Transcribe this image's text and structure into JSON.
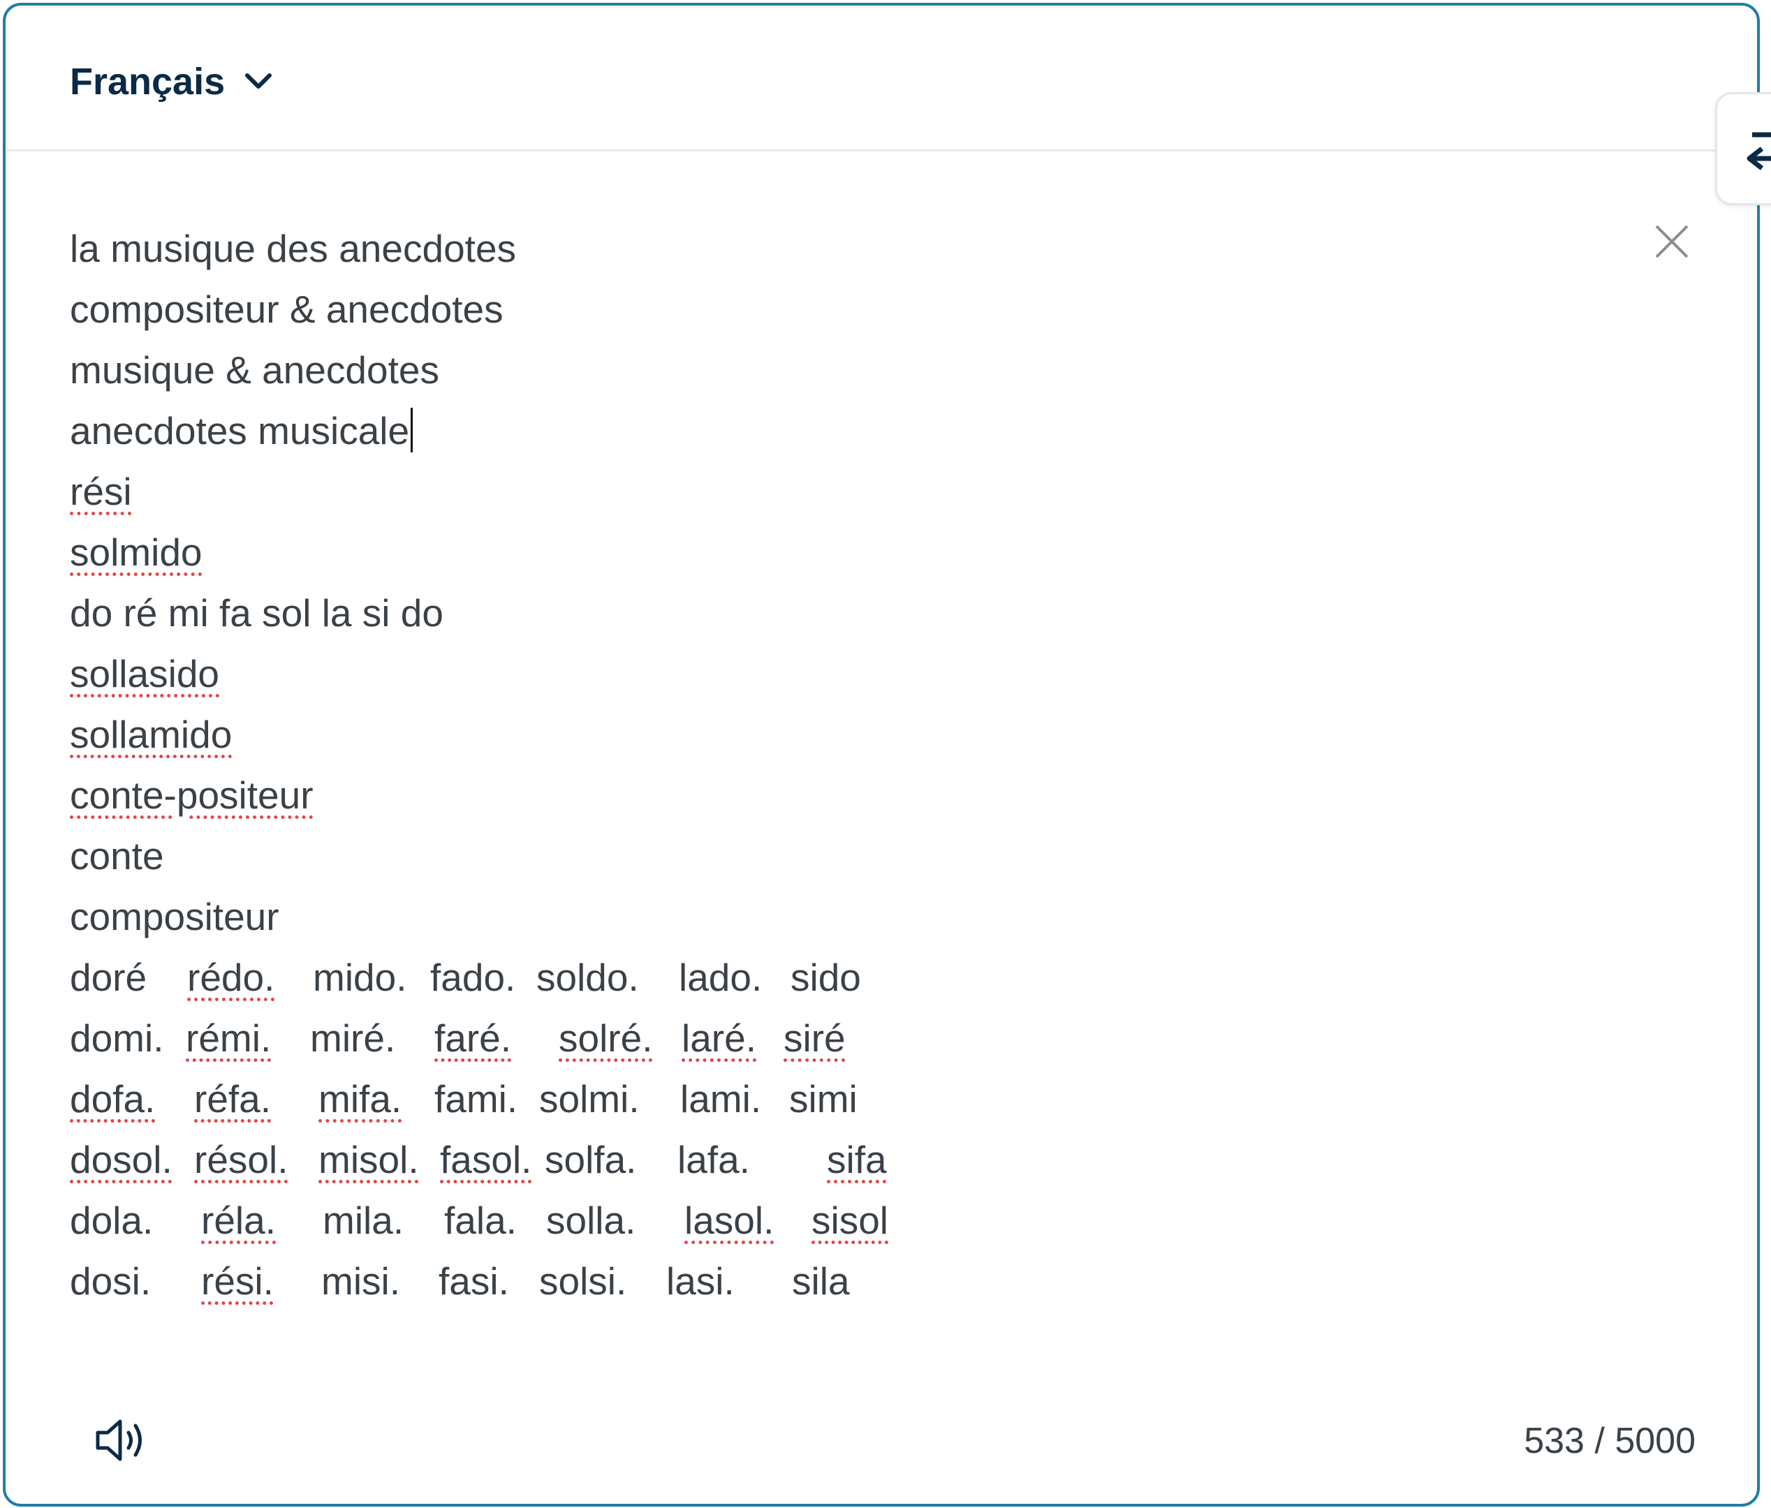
{
  "source_language": "Français",
  "close_label": "",
  "text_lines": [
    "la musique des anecdotes",
    "compositeur & anecdotes",
    "musique & anecdotes",
    "anecdotes musicale"
  ],
  "spell_lines": [
    "rési",
    "solmido"
  ],
  "mid_line": "do ré mi fa sol la si do",
  "spell_lines_2": [
    "sollasido",
    "sollamido",
    "conte-positeur"
  ],
  "plain_lines": [
    "conte",
    "compositeur"
  ],
  "syllable_grid": [
    [
      "doré",
      "rédo.",
      "mido.",
      "fado.",
      "soldo.",
      "lado.",
      "sido"
    ],
    [
      "domi.",
      "rémi.",
      "miré.",
      "faré.",
      "solré.",
      "laré.",
      "siré"
    ],
    [
      "dofa.",
      "réfa.",
      "mifa.",
      "fami.",
      "solmi.",
      "lami.",
      "simi"
    ],
    [
      "dosol.",
      "résol.",
      "misol.",
      "fasol.",
      "solfa.",
      "lafa.",
      "sifa"
    ],
    [
      "dola.",
      "réla.",
      "mila.",
      "fala.",
      "solla.",
      "lasol.",
      "sisol"
    ],
    [
      "dosi.",
      "rési.",
      "misi.",
      "fasi.",
      "solsi.",
      "lasi.",
      "sila"
    ]
  ],
  "char_count": "533 / 5000",
  "icons": {
    "chevron": "chevron-down-icon",
    "close": "close-icon",
    "speaker": "speaker-icon",
    "swap": "swap-icon"
  },
  "colors": {
    "border": "#1f7fa6",
    "title": "#0b2a45",
    "text": "#3a4147",
    "spell": "#e0474c"
  }
}
